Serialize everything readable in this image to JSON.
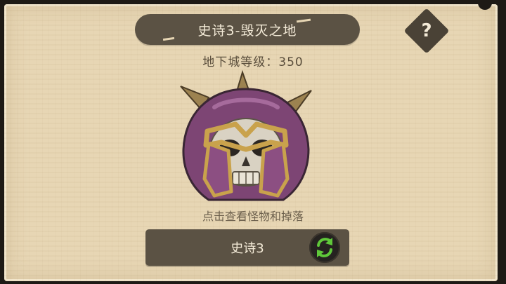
{
  "dungeon": {
    "title": "史诗3-毁灭之地",
    "level_text": "地下城等级：350",
    "hint": "点击查看怪物和掉落",
    "mode_label": "史诗3"
  },
  "icons": {
    "help": "question-mark-icon",
    "switch": "refresh-arrows-icon",
    "boss": "skull-helmet-icon"
  },
  "help_glyph": "?",
  "colors": {
    "parchment": "#e7d6b4",
    "banner": "#5b5244",
    "helmet_purple": "#8c4f82",
    "helmet_gold": "#c9a24c",
    "switch_green": "#5fc83a"
  }
}
